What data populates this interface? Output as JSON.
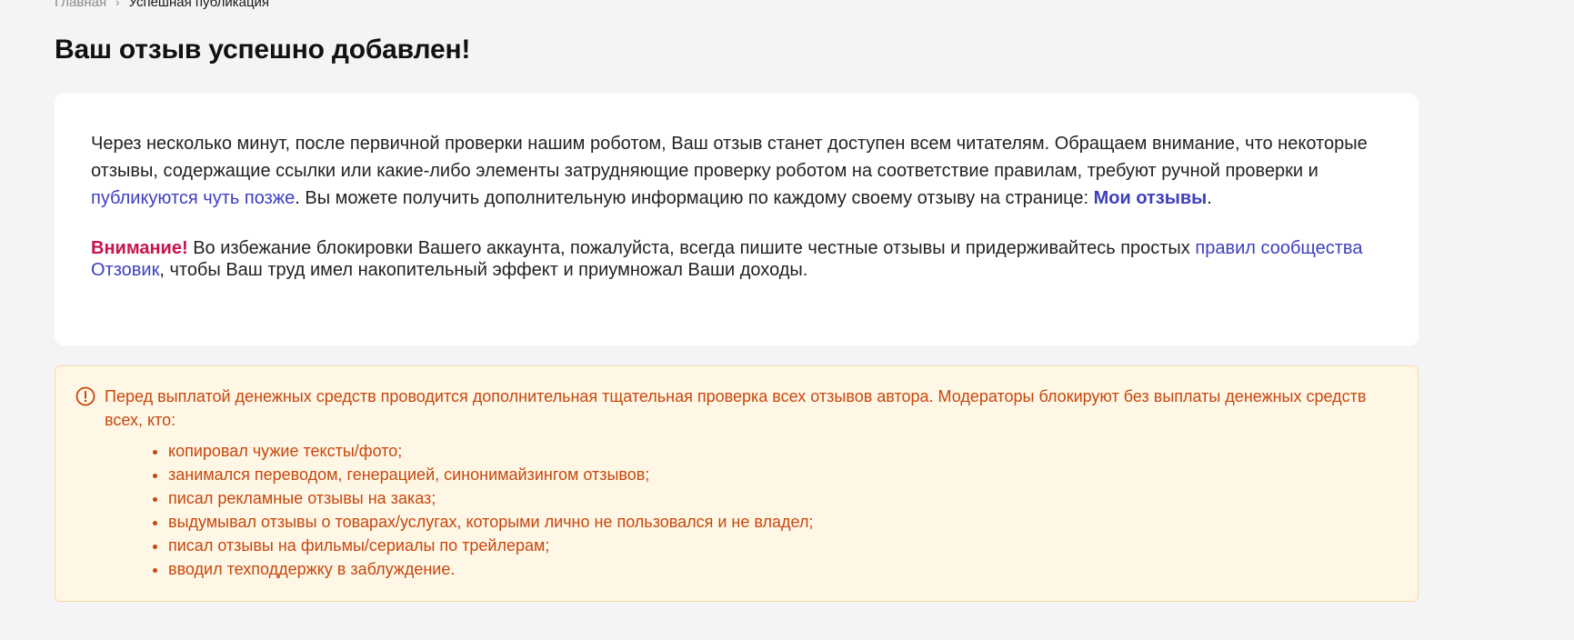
{
  "breadcrumb": {
    "home": "Главная",
    "separator": "›",
    "current": "Успешная публикация"
  },
  "title": "Ваш отзыв успешно добавлен!",
  "card": {
    "p1_before_link": "Через несколько минут, после первичной проверки нашим роботом, Ваш отзыв станет доступен всем читателям. Обращаем внимание, что некоторые отзывы, содержащие ссылки или какие-либо элементы затрудняющие проверку роботом на соответствие правилам, требуют ручной проверки и ",
    "p1_link": "публикуются чуть позже",
    "p1_after_link": ". Вы можете получить дополнительную информацию по каждому своему отзыву на странице: ",
    "my_reviews_link": "Мои отзывы",
    "p1_end": ".",
    "attention_label": "Внимание!",
    "p2_before_link": " Во избежание блокировки Вашего аккаунта, пожалуйста, всегда пишите честные отзывы и придерживайтесь простых ",
    "p2_link": "правил сообщества Отзовик",
    "p2_after_link": ", чтобы Ваш труд имел накопительный эффект и приумножал Ваши доходы."
  },
  "notice": {
    "icon": "exclamation-circle-icon",
    "text": "Перед выплатой денежных средств проводится дополнительная тщательная проверка всех отзывов автора. Модераторы блокируют без выплаты денежных средств всех, кто:",
    "items": [
      "копировал чужие тексты/фото;",
      "занимался переводом, генерацией, синонимайзингом отзывов;",
      "писал рекламные отзывы на заказ;",
      "выдумывал отзывы о товарах/услугах, которыми лично не пользовался и не владел;",
      "писал отзывы на фильмы/сериалы по трейлерам;",
      "вводил техподдержку в заблуждение."
    ]
  },
  "colors": {
    "background": "#f4f4f6",
    "link": "#3d3fbf",
    "attention": "#c8144b",
    "notice_text": "#c7470d",
    "notice_bg": "#fff7e6",
    "notice_border": "#f5d9a8"
  }
}
